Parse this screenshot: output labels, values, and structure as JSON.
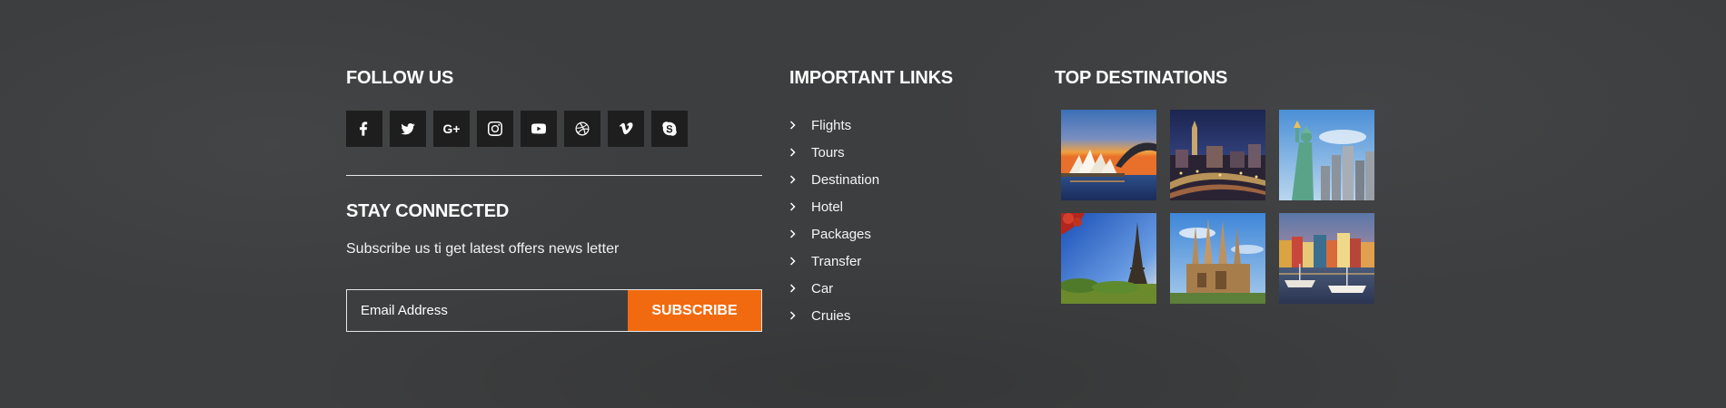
{
  "follow": {
    "title": "FOLLOW US",
    "socials": [
      {
        "icon": "facebook-icon"
      },
      {
        "icon": "twitter-icon"
      },
      {
        "icon": "google-plus-icon",
        "text": "G+"
      },
      {
        "icon": "instagram-icon"
      },
      {
        "icon": "youtube-icon"
      },
      {
        "icon": "dribbble-icon"
      },
      {
        "icon": "vimeo-icon"
      },
      {
        "icon": "skype-icon"
      }
    ]
  },
  "stay": {
    "title": "STAY CONNECTED",
    "text": "Subscribe us ti get latest offers news letter",
    "placeholder": "Email Address",
    "button": "SUBSCRIBE"
  },
  "links": {
    "title": "IMPORTANT LINKS",
    "items": [
      "Flights",
      "Tours",
      "Destination",
      "Hotel",
      "Packages",
      "Transfer",
      "Car",
      "Cruies"
    ]
  },
  "destinations": {
    "title": "TOP DESTINATIONS",
    "images": [
      "sydney-opera-house",
      "city-night-skyline",
      "statue-of-liberty",
      "eiffel-tower",
      "sagrada-familia",
      "harbor-canal"
    ]
  },
  "colors": {
    "background": "#3d3e3f",
    "accent": "#f26a10",
    "social_bg": "#1e1e1e"
  }
}
